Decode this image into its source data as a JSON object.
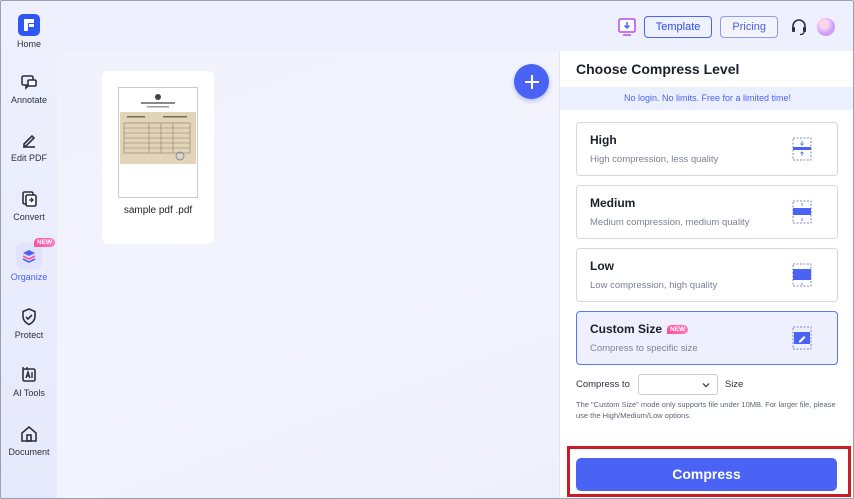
{
  "sidebar": {
    "items": [
      {
        "label": "Home",
        "icon": "home-logo-icon"
      },
      {
        "label": "Annotate",
        "icon": "annotate-icon"
      },
      {
        "label": "Edit PDF",
        "icon": "edit-pdf-icon"
      },
      {
        "label": "Convert",
        "icon": "convert-icon"
      },
      {
        "label": "Organize",
        "icon": "organize-icon",
        "badge": "NEW",
        "active": true
      },
      {
        "label": "Protect",
        "icon": "shield-icon"
      },
      {
        "label": "AI Tools",
        "icon": "ai-tools-icon"
      },
      {
        "label": "Document",
        "icon": "document-home-icon"
      }
    ]
  },
  "topbar": {
    "template_label": "Template",
    "pricing_label": "Pricing"
  },
  "workspace": {
    "file_name": "sample pdf .pdf"
  },
  "panel": {
    "title": "Choose Compress Level",
    "promo": "No login. No limits. Free for a limited time!",
    "options": [
      {
        "title": "High",
        "subtitle": "High compression, less quality"
      },
      {
        "title": "Medium",
        "subtitle": "Medium compression, medium quality"
      },
      {
        "title": "Low",
        "subtitle": "Low compression, high quality"
      },
      {
        "title": "Custom Size",
        "subtitle": "Compress to specific size",
        "badge": "NEW",
        "selected": true
      }
    ],
    "compress_to_label": "Compress to",
    "size_label": "Size",
    "size_value": "",
    "note": "The \"Custom Size\" mode only supports file under 10MB. For larger file, please use the High/Medium/Low options.",
    "compress_button": "Compress"
  },
  "colors": {
    "accent": "#4a63f5",
    "highlight_border": "#cc1b22",
    "badge": "#ff4f9b"
  }
}
